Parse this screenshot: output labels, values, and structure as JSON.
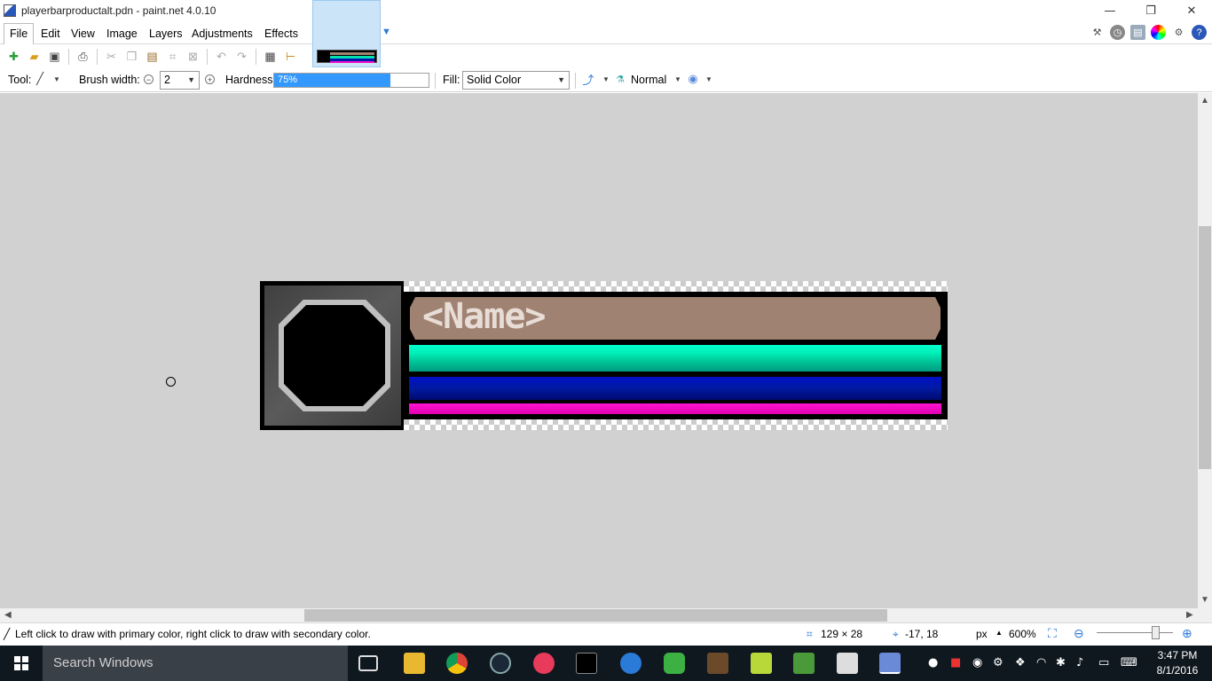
{
  "window": {
    "title": "playerbarproductalt.pdn - paint.net 4.0.10",
    "minimize": "—",
    "restore": "❐",
    "close": "✕"
  },
  "menu": {
    "items": [
      "File",
      "Edit",
      "View",
      "Image",
      "Layers",
      "Adjustments",
      "Effects"
    ]
  },
  "toolbar": {
    "tool_label": "Tool:",
    "brush_width_label": "Brush width:",
    "brush_width_value": "2",
    "hardness_label": "Hardness:",
    "hardness_value": "75%",
    "hardness_level": 0.75,
    "fill_label": "Fill:",
    "fill_value": "Solid Color",
    "blend_mode": "Normal"
  },
  "canvas": {
    "name_placeholder": "<Name>",
    "colors": {
      "background": "#d1d1d1",
      "name_bar": "#a08273",
      "green_bar": "#00e0b0",
      "blue_bar": "#0016b0",
      "pink_bar": "#f010c8"
    }
  },
  "status": {
    "hint": "Left click to draw with primary color, right click to draw with secondary color.",
    "image_size": "129 × 28",
    "cursor_pos": "-17, 18",
    "units": "px",
    "zoom": "600%"
  },
  "taskbar": {
    "search_placeholder": "Search Windows",
    "time": "3:47 PM",
    "date": "8/1/2016"
  }
}
